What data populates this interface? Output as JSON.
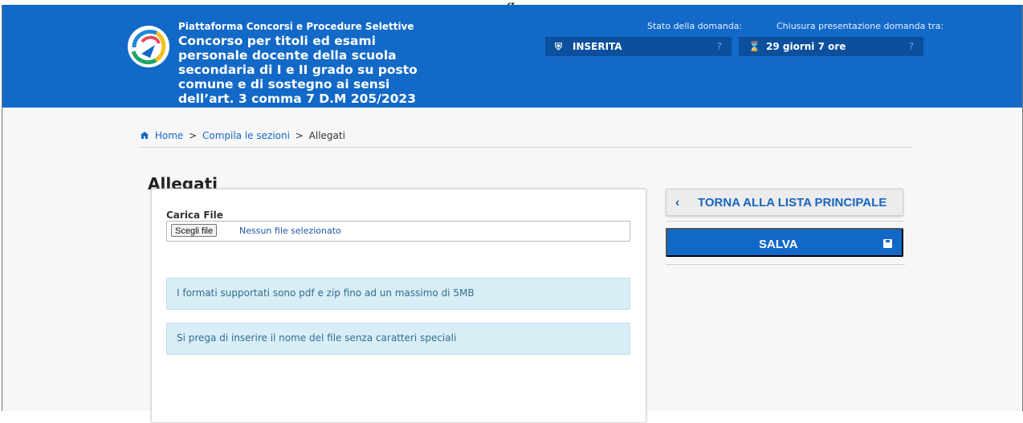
{
  "top_fragment": "g",
  "header": {
    "platform_name": "Piattaforma Concorsi e Procedure Selettive",
    "contest_title": "Concorso per titoli ed esami personale docente della scuola secondaria di I e II grado su posto comune e di sostegno ai sensi dell’art. 3 comma 7 D.M 205/2023",
    "status_label": "Stato della domanda:",
    "status_value": "INSERITA",
    "closing_label": "Chiusura presentazione domanda tra:",
    "closing_value": "29 giorni 7 ore",
    "help_symbol": "?"
  },
  "breadcrumb": {
    "home": "Home",
    "compile_sections": "Compila le sezioni",
    "current": "Allegati",
    "separator": ">"
  },
  "page": {
    "title": "Allegati"
  },
  "upload": {
    "label": "Carica File",
    "choose_button": "Scegli file",
    "selected_file_text": "Nessun file selezionato",
    "info_formats": "I formati supportati sono pdf e zip fino ad un massimo di 5MB",
    "info_filename": "Si prega di inserire il nome del file senza caratteri speciali"
  },
  "actions": {
    "back_label": "TORNA ALLA LISTA PRINCIPALE",
    "save_label": "SALVA"
  },
  "colors": {
    "header_blue": "#1269c7",
    "info_background": "#d9edf7",
    "link_blue": "#1769c5"
  },
  "icons": {
    "logo": "platform-logo",
    "status": "shield-icon",
    "closing": "hourglass-icon",
    "home": "home-icon",
    "back": "chevron-left-icon",
    "save": "save-icon"
  }
}
